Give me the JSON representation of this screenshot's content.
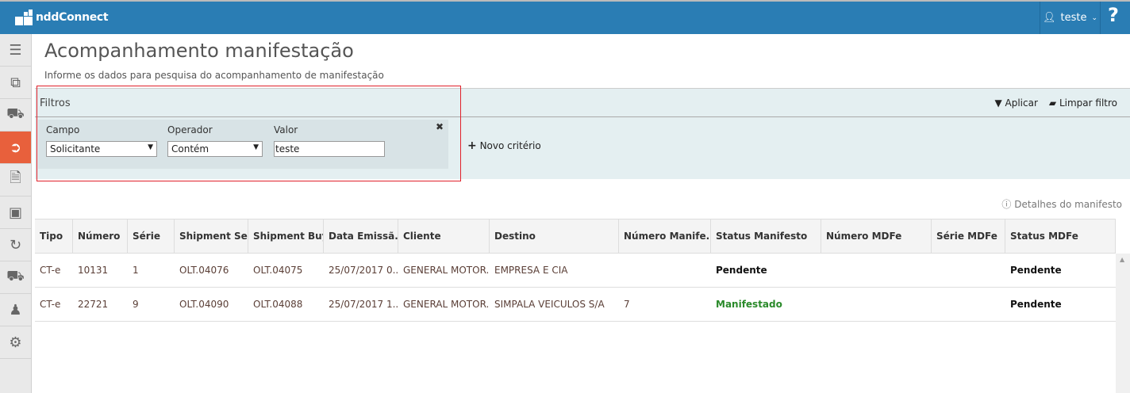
{
  "app": {
    "brand": "nddConnect",
    "user": "teste",
    "help": "?"
  },
  "page": {
    "title": "Acompanhamento manifestação",
    "subtitle": "Informe os dados para pesquisa do acompanhamento de manifestação"
  },
  "sidebar": {
    "items": [
      "menu-icon",
      "documents-icon",
      "truck-icon",
      "export-icon",
      "file-text-icon",
      "money-icon",
      "money-cycle-icon",
      "delivery-truck-icon",
      "users-icon",
      "gears-icon"
    ],
    "active_index": 3,
    "accent": "#e8603c"
  },
  "filters": {
    "title": "Filtros",
    "apply": "Aplicar",
    "clear": "Limpar filtro",
    "new_criterion": "Novo critério",
    "criterion": {
      "field_label": "Campo",
      "field_value": "Solicitante",
      "operator_label": "Operador",
      "operator_value": "Contém",
      "value_label": "Valor",
      "value": "teste"
    }
  },
  "details_link": "Detalhes do manifesto",
  "table": {
    "columns": [
      "Tipo",
      "Número",
      "Série",
      "Shipment Sell",
      "Shipment Buy",
      "Data Emissã...",
      "Cliente",
      "Destino",
      "Número Manife...",
      "Status Manifesto",
      "Número MDFe",
      "Série MDFe",
      "Status MDFe"
    ],
    "rows": [
      [
        "CT-e",
        "10131",
        "1",
        "OLT.04076",
        "OLT.04075",
        "25/07/2017 0...",
        "GENERAL MOTOR...",
        "EMPRESA E CIA",
        "",
        "Pendente",
        "",
        "",
        "Pendente"
      ],
      [
        "CT-e",
        "22721",
        "9",
        "OLT.04090",
        "OLT.04088",
        "25/07/2017 1...",
        "GENERAL MOTOR...",
        "SIMPALA VEICULOS S/A",
        "7",
        "Manifestado",
        "",
        "",
        "Pendente"
      ]
    ]
  }
}
